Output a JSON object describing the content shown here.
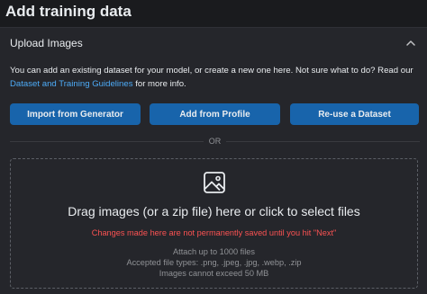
{
  "page": {
    "title": "Add training data"
  },
  "section": {
    "title": "Upload Images",
    "intro_text": "You can add an existing dataset for your model, or create a new one here. Not sure what to do? Read our ",
    "intro_link": "Dataset and Training Guidelines",
    "intro_suffix": " for more info."
  },
  "buttons": {
    "import": "Import from Generator",
    "profile": "Add from Profile",
    "reuse": "Re-use a Dataset"
  },
  "divider": {
    "label": "OR"
  },
  "dropzone": {
    "title": "Drag images (or a zip file) here or click to select files",
    "warning": "Changes made here are not permanently saved until you hit \"Next\"",
    "info_limit": "Attach up to 1000 files",
    "info_types": "Accepted file types: .png, .jpeg, .jpg, .webp, .zip",
    "info_size": "Images cannot exceed 50 MB"
  },
  "colors": {
    "accent_button": "#1864ab",
    "link": "#4dabf7",
    "warning": "#fa5252",
    "background": "#1a1b1e",
    "card": "#25262b"
  },
  "icons": {
    "collapse": "chevron-up-icon",
    "upload": "photo-icon"
  }
}
